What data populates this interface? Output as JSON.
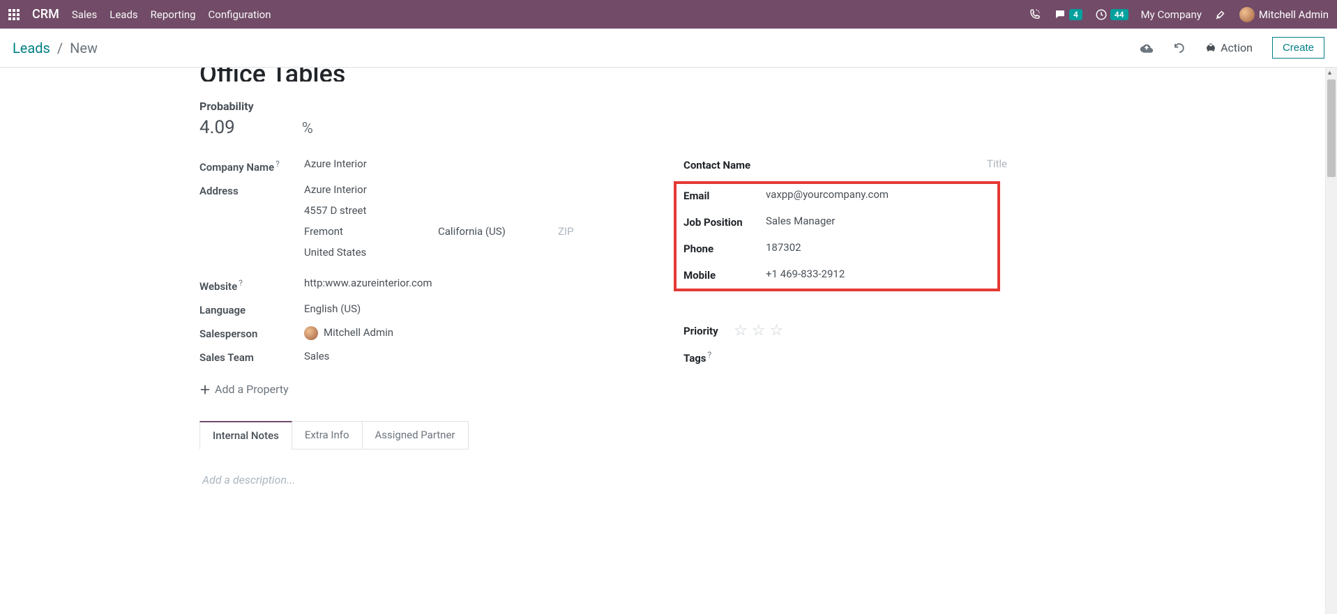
{
  "topbar": {
    "brand": "CRM",
    "nav": [
      "Sales",
      "Leads",
      "Reporting",
      "Configuration"
    ],
    "messages_badge": "4",
    "activities_badge": "44",
    "company": "My Company",
    "user": "Mitchell Admin"
  },
  "breadcrumb": {
    "parent": "Leads",
    "current": "New",
    "action_label": "Action",
    "create_label": "Create"
  },
  "lead": {
    "title_partial": "Office Tables",
    "probability_label": "Probability",
    "probability": "4.09",
    "pct": "%",
    "company_name_label": "Company Name",
    "company_name": "Azure Interior",
    "address_label": "Address",
    "address": {
      "street": "Azure Interior",
      "street2": "4557 D street",
      "city": "Fremont",
      "state": "California (US)",
      "zip_ph": "ZIP",
      "country": "United States"
    },
    "website_label": "Website",
    "website": "http:www.azureinterior.com",
    "language_label": "Language",
    "language": "English (US)",
    "salesperson_label": "Salesperson",
    "salesperson": "Mitchell Admin",
    "sales_team_label": "Sales Team",
    "sales_team": "Sales",
    "add_property": "Add a Property",
    "contact_name_label": "Contact Name",
    "title_ph": "Title",
    "email_label": "Email",
    "email": "vaxpp@yourcompany.com",
    "job_label": "Job Position",
    "job": "Sales Manager",
    "phone_label": "Phone",
    "phone": "187302",
    "mobile_label": "Mobile",
    "mobile": "+1 469-833-2912",
    "priority_label": "Priority",
    "tags_label": "Tags"
  },
  "tabs": {
    "internal_notes": "Internal Notes",
    "extra_info": "Extra Info",
    "assigned_partner": "Assigned Partner"
  },
  "description_ph": "Add a description..."
}
